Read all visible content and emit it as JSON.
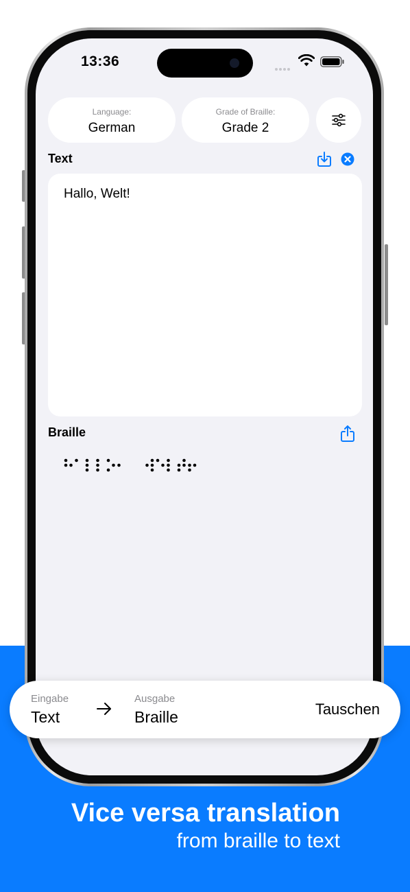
{
  "status_bar": {
    "time": "13:36"
  },
  "selectors": {
    "language": {
      "label": "Language:",
      "value": "German"
    },
    "grade": {
      "label": "Grade of Braille:",
      "value": "Grade 2"
    },
    "settings_icon": "sliders-icon"
  },
  "text_section": {
    "title": "Text",
    "content": "Hallo, Welt!",
    "import_icon": "import-icon",
    "clear_icon": "clear-icon"
  },
  "braille_section": {
    "title": "Braille",
    "output": "⠓⠁⠇⠇⠕⠂ ⠺⠑⠇⠞⠖",
    "share_icon": "share-icon"
  },
  "mode_bar": {
    "input_label": "Eingabe",
    "input_value": "Text",
    "output_label": "Ausgabe",
    "output_value": "Braille",
    "swap_label": "Tauschen",
    "arrow_icon": "arrow-right-icon"
  },
  "promo": {
    "headline": "Vice versa translation",
    "subheadline": "from braille to text"
  },
  "colors": {
    "accent": "#0a7cff",
    "screen_background": "#f2f2f7",
    "card_background": "#ffffff"
  }
}
